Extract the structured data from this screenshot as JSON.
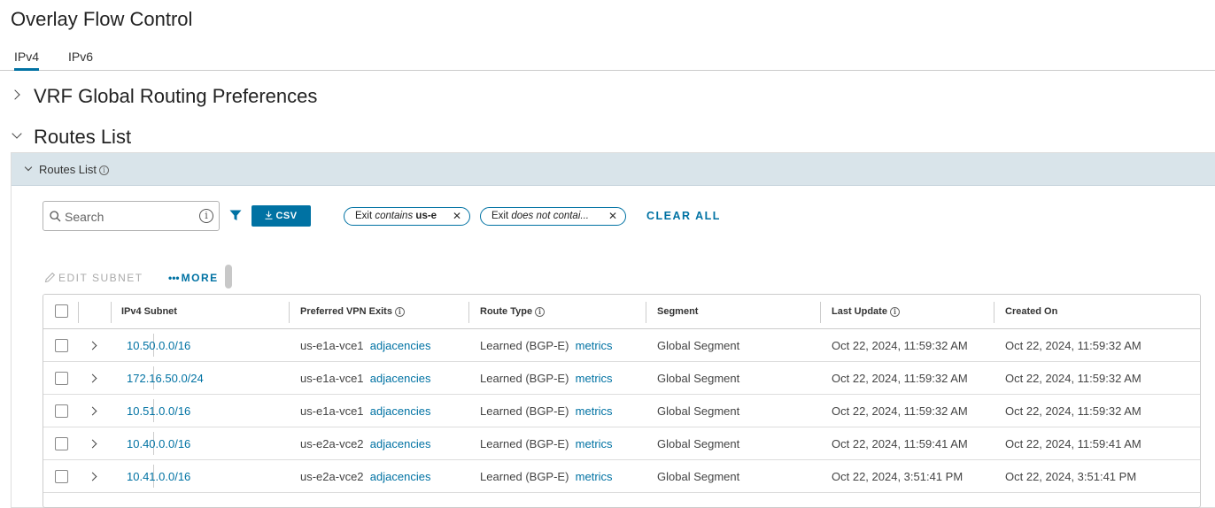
{
  "page": {
    "title": "Overlay Flow Control"
  },
  "tabs": [
    {
      "label": "IPv4",
      "active": true
    },
    {
      "label": "IPv6",
      "active": false
    }
  ],
  "sections": {
    "vrf": {
      "title": "VRF Global Routing Preferences",
      "expanded": false
    },
    "routes": {
      "title": "Routes List",
      "expanded": true
    }
  },
  "panel": {
    "title": "Routes List"
  },
  "toolbar": {
    "search_placeholder": "Search",
    "csv_label": "CSV",
    "filters": [
      {
        "prefix": "Exit",
        "operator": "contains",
        "value": "us-e"
      },
      {
        "prefix": "Exit",
        "operator": "does not contai...",
        "value": ""
      }
    ],
    "clear_all_label": "CLEAR ALL",
    "edit_subnet_label": "EDIT SUBNET",
    "more_label": "MORE"
  },
  "table": {
    "columns": [
      "IPv4 Subnet",
      "Preferred VPN Exits",
      "Route Type",
      "Segment",
      "Last Update",
      "Created On"
    ],
    "rows": [
      {
        "subnet": "10.50.0.0/16",
        "exit": "us-e1a-vce1",
        "exit_link": "adjacencies",
        "route_type": "Learned (BGP-E)",
        "route_link": "metrics",
        "segment": "Global Segment",
        "last_update": "Oct 22, 2024, 11:59:32 AM",
        "created_on": "Oct 22, 2024, 11:59:32 AM"
      },
      {
        "subnet": "172.16.50.0/24",
        "exit": "us-e1a-vce1",
        "exit_link": "adjacencies",
        "route_type": "Learned (BGP-E)",
        "route_link": "metrics",
        "segment": "Global Segment",
        "last_update": "Oct 22, 2024, 11:59:32 AM",
        "created_on": "Oct 22, 2024, 11:59:32 AM"
      },
      {
        "subnet": "10.51.0.0/16",
        "exit": "us-e1a-vce1",
        "exit_link": "adjacencies",
        "route_type": "Learned (BGP-E)",
        "route_link": "metrics",
        "segment": "Global Segment",
        "last_update": "Oct 22, 2024, 11:59:32 AM",
        "created_on": "Oct 22, 2024, 11:59:32 AM"
      },
      {
        "subnet": "10.40.0.0/16",
        "exit": "us-e2a-vce2",
        "exit_link": "adjacencies",
        "route_type": "Learned (BGP-E)",
        "route_link": "metrics",
        "segment": "Global Segment",
        "last_update": "Oct 22, 2024, 11:59:41 AM",
        "created_on": "Oct 22, 2024, 11:59:41 AM"
      },
      {
        "subnet": "10.41.0.0/16",
        "exit": "us-e2a-vce2",
        "exit_link": "adjacencies",
        "route_type": "Learned (BGP-E)",
        "route_link": "metrics",
        "segment": "Global Segment",
        "last_update": "Oct 22, 2024, 3:51:41 PM",
        "created_on": "Oct 22, 2024, 3:51:41 PM"
      }
    ]
  },
  "colors": {
    "accent": "#0072a3",
    "panel_header_bg": "#d9e4ea"
  },
  "icons": {
    "search": "search-icon",
    "info": "info-icon",
    "filter": "filter-icon",
    "download": "download-icon",
    "close": "close-icon",
    "edit": "pencil-icon",
    "expand": "chevron-right-icon"
  }
}
